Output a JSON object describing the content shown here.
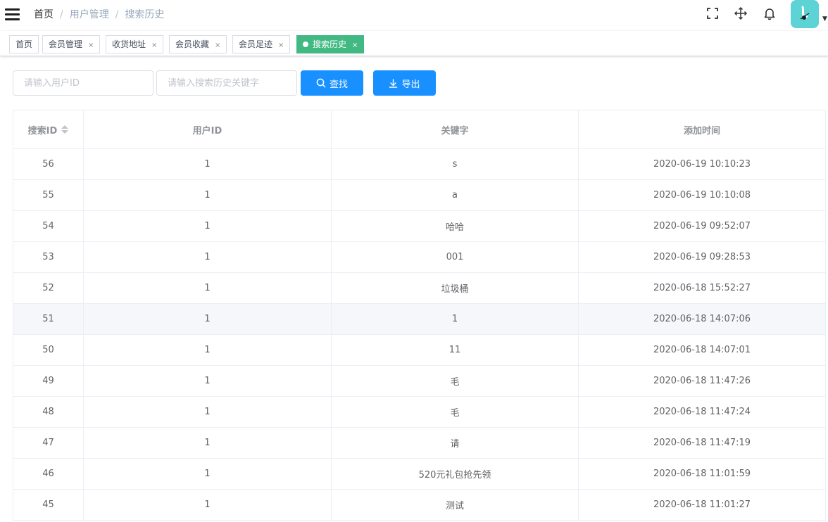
{
  "navbar": {
    "breadcrumb": [
      {
        "label": "首页"
      },
      {
        "label": "用户管理"
      },
      {
        "label": "搜索历史"
      }
    ],
    "tools": [
      "fullscreen-icon",
      "move-icon",
      "bell-icon"
    ],
    "avatar": "avatar-image"
  },
  "tags": [
    {
      "label": "首页",
      "closable": false,
      "active": false
    },
    {
      "label": "会员管理",
      "closable": true,
      "active": false
    },
    {
      "label": "收货地址",
      "closable": true,
      "active": false
    },
    {
      "label": "会员收藏",
      "closable": true,
      "active": false
    },
    {
      "label": "会员足迹",
      "closable": true,
      "active": false
    },
    {
      "label": "搜索历史",
      "closable": true,
      "active": true
    }
  ],
  "tag_close_glyph": "×",
  "filters": {
    "user_id_placeholder": "请输入用户ID",
    "keyword_placeholder": "请输入搜索历史关键字",
    "search_label": "查找",
    "export_label": "导出"
  },
  "colors": {
    "primary": "#1890ff",
    "tag_active": "#42b983"
  },
  "table": {
    "columns": [
      "搜索ID",
      "用户ID",
      "关键字",
      "添加时间"
    ],
    "rows": [
      [
        "56",
        "1",
        "s",
        "2020-06-19 10:10:23"
      ],
      [
        "55",
        "1",
        "a",
        "2020-06-19 10:10:08"
      ],
      [
        "54",
        "1",
        "哈哈",
        "2020-06-19 09:52:07"
      ],
      [
        "53",
        "1",
        "001",
        "2020-06-19 09:28:53"
      ],
      [
        "52",
        "1",
        "垃圾桶",
        "2020-06-18 15:52:27"
      ],
      [
        "51",
        "1",
        "1",
        "2020-06-18 14:07:06"
      ],
      [
        "50",
        "1",
        "11",
        "2020-06-18 14:07:01"
      ],
      [
        "49",
        "1",
        "毛",
        "2020-06-18 11:47:26"
      ],
      [
        "48",
        "1",
        "毛",
        "2020-06-18 11:47:24"
      ],
      [
        "47",
        "1",
        "请",
        "2020-06-18 11:47:19"
      ],
      [
        "46",
        "1",
        "520元礼包抢先领",
        "2020-06-18 11:01:59"
      ],
      [
        "45",
        "1",
        "测试",
        "2020-06-18 11:01:27"
      ]
    ],
    "hovered_row": 5
  }
}
